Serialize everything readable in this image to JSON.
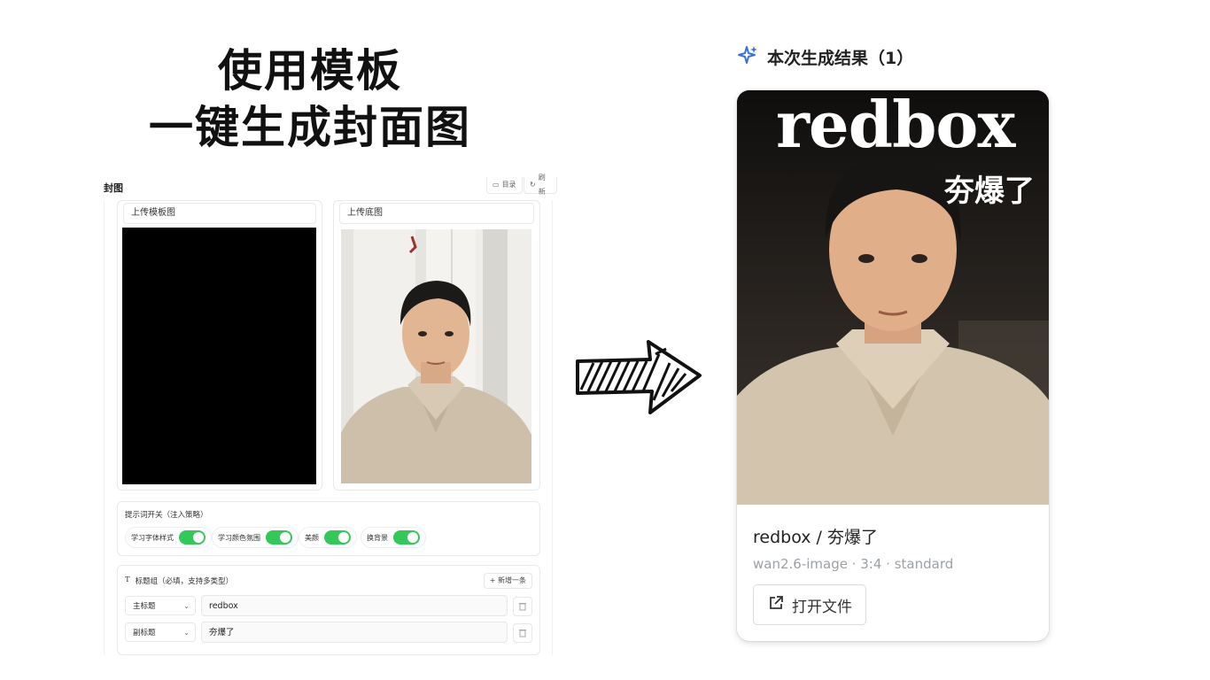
{
  "headline": {
    "line1": "使用模板",
    "line2": "一键生成封面图"
  },
  "editor": {
    "title": "封图",
    "top_buttons": [
      "目录",
      "刷新"
    ],
    "template_card": {
      "caption": "上传模板图"
    },
    "base_card": {
      "caption": "上传底图"
    },
    "prompt_section": {
      "label": "提示词开关（注入策略）",
      "toggles": [
        {
          "label": "学习字体样式",
          "on": true
        },
        {
          "label": "学习颜色氛围",
          "on": true
        },
        {
          "label": "美颜",
          "on": true
        },
        {
          "label": "换背景",
          "on": true
        }
      ]
    },
    "title_group": {
      "label": "标题组（必填，支持多类型）",
      "add_label": "+ 新增一条",
      "rows": [
        {
          "type": "主标题",
          "value": "redbox"
        },
        {
          "type": "副标题",
          "value": "夯爆了"
        }
      ]
    }
  },
  "result": {
    "header": "本次生成结果（1）",
    "cover_title": "redbox",
    "cover_subtitle": "夯爆了",
    "name": "redbox / 夯爆了",
    "meta": "wan2.6-image · 3:4 · standard",
    "open_label": "打开文件"
  },
  "colors": {
    "accent_green": "#34c759",
    "sparkle_blue": "#3b6fd8"
  }
}
